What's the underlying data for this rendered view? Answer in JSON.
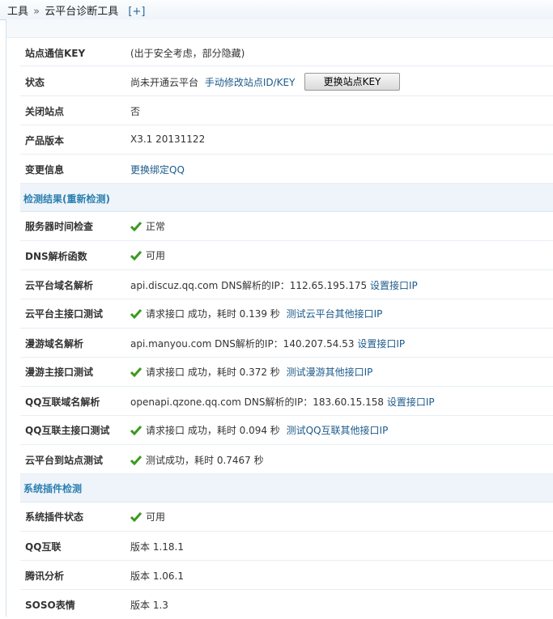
{
  "breadcrumb": {
    "root": "工具",
    "sep": "»",
    "current": "云平台诊断工具",
    "expand": "[+]"
  },
  "site_info": {
    "key_label": "站点通信KEY",
    "key_value": "(出于安全考虑，部分隐藏)",
    "status_label": "状态",
    "status_value": "尚未开通云平台",
    "status_link": "手动修改站点ID/KEY",
    "status_button": "更换站点KEY",
    "close_label": "关闭站点",
    "close_value": "否",
    "version_label": "产品版本",
    "version_value": "X3.1 20131122",
    "change_label": "变更信息",
    "change_link": "更换绑定QQ"
  },
  "check_section": {
    "title": "检测结果(重新检测)"
  },
  "checks": {
    "time_label": "服务器时间检查",
    "time_value": "正常",
    "dns_label": "DNS解析函数",
    "dns_value": "可用",
    "cloud_dns_label": "云平台域名解析",
    "cloud_dns_value": "api.discuz.qq.com DNS解析的IP：112.65.195.175",
    "cloud_dns_link": "设置接口IP",
    "cloud_api_label": "云平台主接口测试",
    "cloud_api_value": "请求接口 成功，耗时 0.139 秒",
    "cloud_api_link": "测试云平台其他接口IP",
    "manyou_dns_label": "漫游域名解析",
    "manyou_dns_value": "api.manyou.com DNS解析的IP：140.207.54.53",
    "manyou_dns_link": "设置接口IP",
    "manyou_api_label": "漫游主接口测试",
    "manyou_api_value": "请求接口 成功，耗时 0.372 秒",
    "manyou_api_link": "测试漫游其他接口IP",
    "qq_dns_label": "QQ互联域名解析",
    "qq_dns_value": "openapi.qzone.qq.com DNS解析的IP：183.60.15.158",
    "qq_dns_link": "设置接口IP",
    "qq_api_label": "QQ互联主接口测试",
    "qq_api_value": "请求接口 成功，耗时 0.094 秒",
    "qq_api_link": "测试QQ互联其他接口IP",
    "site_test_label": "云平台到站点测试",
    "site_test_value": "测试成功，耗时 0.7467 秒"
  },
  "plugin_section": {
    "title": "系统插件检测"
  },
  "plugins": {
    "status_label": "系统插件状态",
    "status_value": "可用",
    "qq_label": "QQ互联",
    "qq_value": "版本 1.18.1",
    "tencent_label": "腾讯分析",
    "tencent_value": "版本 1.06.1",
    "soso_label": "SOSO表情",
    "soso_value": "版本 1.3"
  },
  "colors": {
    "link": "#1c5a8a",
    "section_title": "#2b7fb0",
    "ok_icon": "#3a9a1e"
  }
}
